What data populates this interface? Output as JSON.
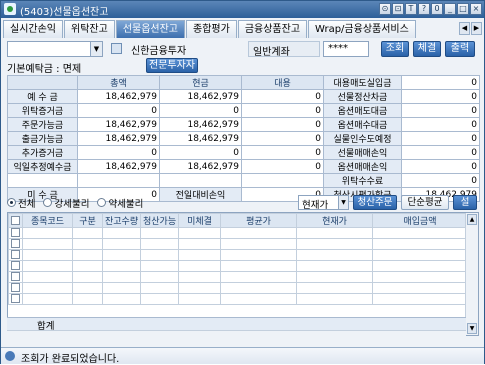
{
  "window": {
    "title": "(5403)선물옵션잔고",
    "title_buttons": [
      "⊙",
      "⊡",
      "T",
      "?",
      "0",
      "_",
      "□",
      "×"
    ]
  },
  "tabs": [
    "실시간손익",
    "위탁잔고",
    "선물옵션잔고",
    "종합평가",
    "금융상품잔고",
    "Wrap/금융상품서비스"
  ],
  "toolbar": {
    "account_name": "신한금융투자",
    "account_type": "일반계좌",
    "password": "****",
    "query_label": "조회",
    "settle_label": "체결",
    "print_label": "출력"
  },
  "margin_info": {
    "label": "기본예탁금 :",
    "value": "면제",
    "pro_investor_label": "전문투자자"
  },
  "summary": {
    "col_headers": [
      "총액",
      "현금",
      "대용"
    ],
    "rows": [
      {
        "label": "예 수 금",
        "total": "18,462,979",
        "cash": "18,462,979",
        "sub": "0",
        "rlabel": "선물정산차금",
        "rvalue": "0"
      },
      {
        "label": "위탁증거금",
        "total": "0",
        "cash": "0",
        "sub": "0",
        "rlabel": "옵션매도대금",
        "rvalue": "0"
      },
      {
        "label": "주문가능금",
        "total": "18,462,979",
        "cash": "18,462,979",
        "sub": "0",
        "rlabel": "옵션매수대금",
        "rvalue": "0"
      },
      {
        "label": "출금가능금",
        "total": "18,462,979",
        "cash": "18,462,979",
        "sub": "0",
        "rlabel": "실물인수도예정",
        "rvalue": "0"
      },
      {
        "label": "추가증거금",
        "total": "0",
        "cash": "0",
        "sub": "0",
        "rlabel": "선물매매손익",
        "rvalue": "0"
      },
      {
        "label": "익일추정예수금",
        "total": "18,462,979",
        "cash": "18,462,979",
        "sub": "0",
        "rlabel": "옵션매매손익",
        "rvalue": "0"
      }
    ],
    "right_header": "대용매도실입금",
    "right_header_value": "0",
    "commission_label": "위탁수수료",
    "commission_value": "0",
    "unpaid_label": "미 수 금",
    "unpaid_value": "0",
    "prev_day_label": "전일대비손익",
    "prev_day_value": "0",
    "liquidation_label": "청산시평가합금",
    "liquidation_value": "18,462,979"
  },
  "filter": {
    "options": [
      "전체",
      "강세불리",
      "약세불리"
    ],
    "selected": "전체",
    "price_select": "현재가",
    "order_button": "청산주문",
    "avg_button": "단순평균",
    "set_button": "설"
  },
  "positions": {
    "headers": [
      "종목코드",
      "구분",
      "잔고수량",
      "청산가능",
      "미체결",
      "평균가",
      "현재가",
      "매입금액"
    ],
    "rows": [],
    "total_label": "합계"
  },
  "status": {
    "message": "조회가 완료되었습니다."
  },
  "colors": {
    "accent": "#2d5f98",
    "grid_border": "#a9bad0",
    "label_bg": "#e3ebf5"
  }
}
